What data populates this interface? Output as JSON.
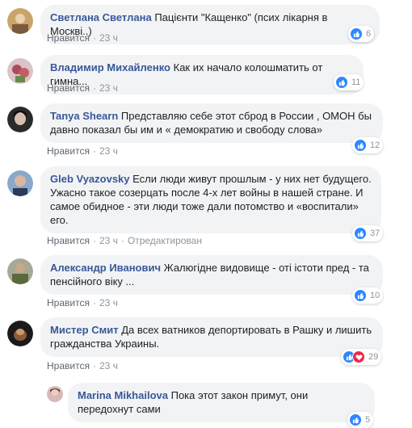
{
  "ui": {
    "like_label": "Нравится",
    "separator": "·"
  },
  "comments": [
    {
      "author": "Светлана Светлана",
      "text": "Пацієнти \"Кащенко\" (псих лікарня в Москві..)",
      "time": "23 ч",
      "edited": "",
      "reactions": [
        "like"
      ],
      "count": "6",
      "avatar_color": "#c9a46a"
    },
    {
      "author": "Владимир Михайленко",
      "text": "Как их начало колошматить от гимна...",
      "time": "23 ч",
      "edited": "",
      "reactions": [
        "like"
      ],
      "count": "11",
      "avatar_color": "#b04a5a"
    },
    {
      "author": "Tanya Shearn",
      "text": "Представляю себе этот сброд в России , ОМОН бы давно показал бы им и « демократию и свободу слова»",
      "time": "23 ч",
      "edited": "",
      "reactions": [
        "like"
      ],
      "count": "12",
      "avatar_color": "#3a3a3a"
    },
    {
      "author": "Gleb Vyazovsky",
      "text": "Если люди живут прошлым - у них нет будущего. Ужасно такое созерцать после 4-х лет войны в нашей стране. И самое обидное - эти люди тоже дали потомство и «воспитали» его.",
      "time": "23 ч",
      "edited": "Отредактирован",
      "reactions": [
        "like"
      ],
      "count": "37",
      "avatar_color": "#6a86a8"
    },
    {
      "author": "Александр Иванович",
      "text": "Жалюгідне видовище - оті істоти пред - та пенсійного віку ...",
      "time": "23 ч",
      "edited": "",
      "reactions": [
        "like"
      ],
      "count": "10",
      "avatar_color": "#7a7a6a"
    },
    {
      "author": "Мистер Смит",
      "text": "Да всех ватников депортировать в Рашку и лишить гражданства Украины.",
      "time": "23 ч",
      "edited": "",
      "reactions": [
        "like",
        "love"
      ],
      "count": "29",
      "avatar_color": "#8a5a3a"
    }
  ],
  "reply": {
    "author": "Marina Mikhailova",
    "text": "Пока этот закон примут, они передохнут сами",
    "count": "5",
    "avatar_color": "#b08a8a"
  }
}
